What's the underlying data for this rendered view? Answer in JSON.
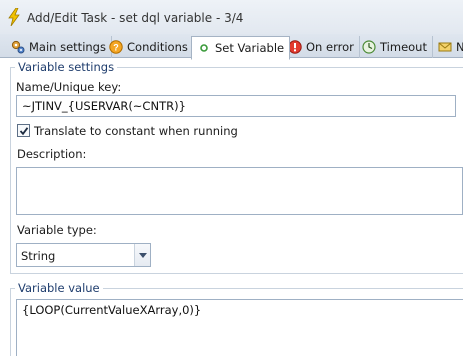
{
  "window": {
    "title": "Add/Edit Task - set dql variable - 3/4",
    "title_icon": "lightning-icon"
  },
  "tabs": [
    {
      "label": "Main settings",
      "icon": "gears-icon",
      "active": false
    },
    {
      "label": "Conditions",
      "icon": "question-icon",
      "active": false
    },
    {
      "label": "Set Variable",
      "icon": "dot-icon",
      "active": true
    },
    {
      "label": "On error",
      "icon": "error-icon",
      "active": false
    },
    {
      "label": "Timeout",
      "icon": "timeout-icon",
      "active": false
    },
    {
      "label": "N",
      "icon": "mail-icon",
      "active": false
    }
  ],
  "variable_settings": {
    "group_title": "Variable settings",
    "name_label": "Name/Unique key:",
    "name_value": "~JTINV_{USERVAR(~CNTR)}",
    "translate_checked": true,
    "translate_label": "Translate to constant when running",
    "description_label": "Description:",
    "description_value": "",
    "type_label": "Variable type:",
    "type_value": "String"
  },
  "variable_value": {
    "group_title": "Variable value",
    "value": "{LOOP(CurrentValueXArray,0)}"
  },
  "colors": {
    "accent": "#1f3d6d",
    "tab_bar": "#d3dce7",
    "border": "#9fb0c4"
  }
}
